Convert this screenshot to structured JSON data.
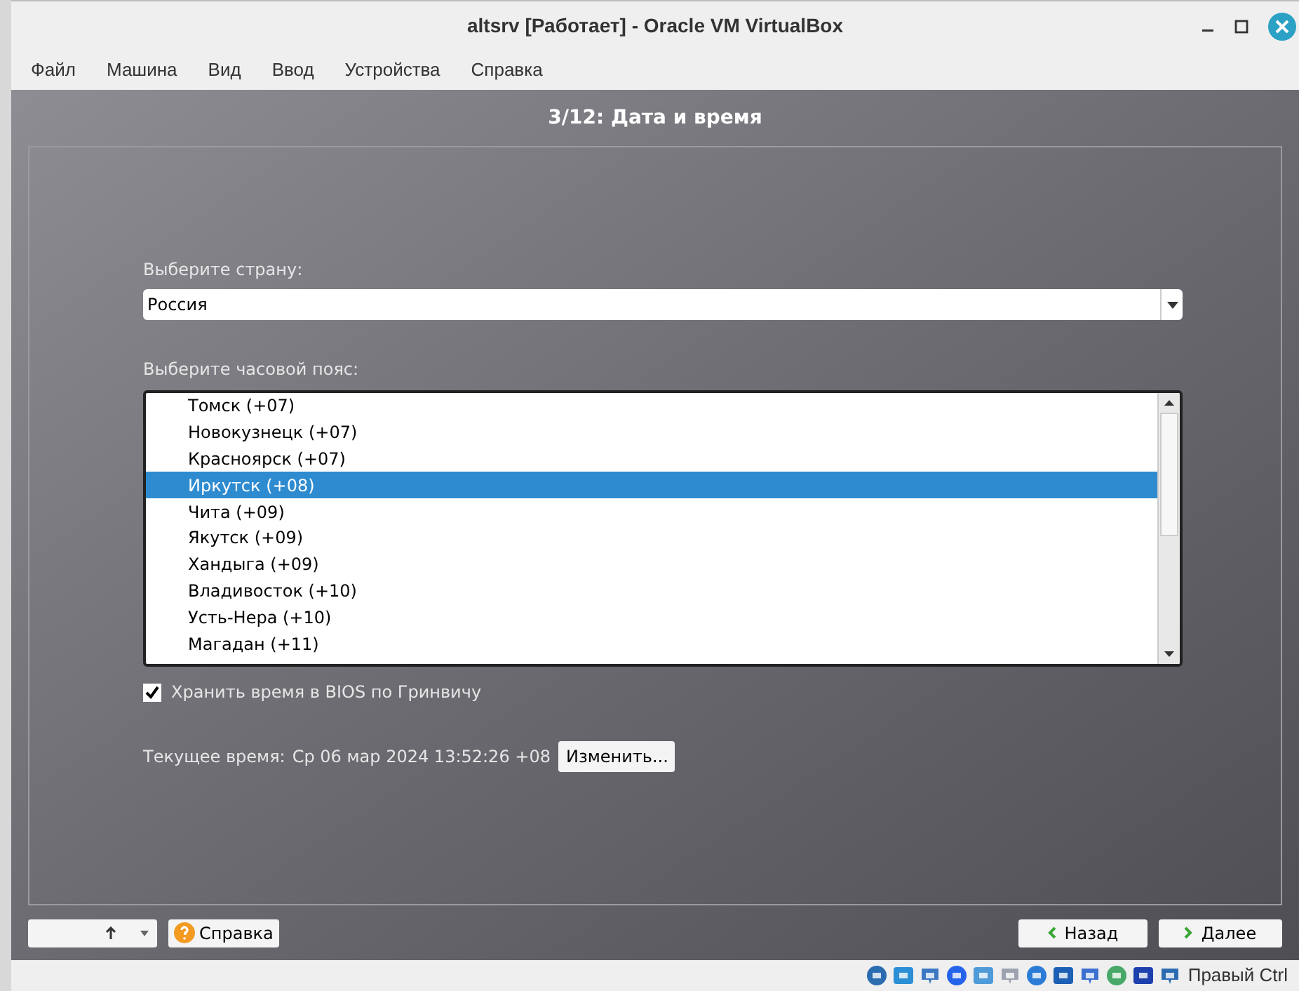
{
  "window": {
    "title": "altsrv [Работает] - Oracle VM VirtualBox"
  },
  "menu": [
    "Файл",
    "Машина",
    "Вид",
    "Ввод",
    "Устройства",
    "Справка"
  ],
  "header": {
    "title": "3/12: Дата и время"
  },
  "country": {
    "label": "Выберите страну:",
    "value": "Россия"
  },
  "timezone": {
    "label": "Выберите часовой пояс:",
    "items": [
      {
        "label": "Томск (+07)",
        "selected": false
      },
      {
        "label": "Новокузнецк (+07)",
        "selected": false
      },
      {
        "label": "Красноярск (+07)",
        "selected": false
      },
      {
        "label": "Иркутск (+08)",
        "selected": true
      },
      {
        "label": "Чита (+09)",
        "selected": false
      },
      {
        "label": "Якутск (+09)",
        "selected": false
      },
      {
        "label": "Хандыга (+09)",
        "selected": false
      },
      {
        "label": "Владивосток (+10)",
        "selected": false
      },
      {
        "label": "Усть-Нера (+10)",
        "selected": false
      },
      {
        "label": "Магадан (+11)",
        "selected": false
      }
    ]
  },
  "bios_utc": {
    "label": "Хранить время в BIOS по Гринвичу",
    "checked": true
  },
  "current_time": {
    "label": "Текущее время:",
    "value": "Ср 06 мар 2024 13:52:26 +08",
    "button": "Изменить..."
  },
  "footer": {
    "help": "Справка",
    "back": "Назад",
    "next": "Далее"
  },
  "status_bar": {
    "host_key": "Правый Ctrl"
  }
}
